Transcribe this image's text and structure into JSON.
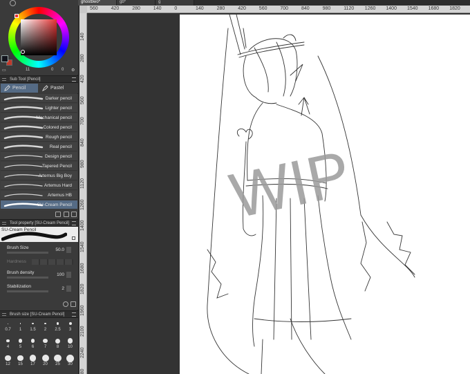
{
  "tabs": [
    {
      "label": "ghostbwo*"
    },
    {
      "label": "gb*"
    },
    {
      "label": "g"
    }
  ],
  "ruler": {
    "top": [
      "560",
      "420",
      "280",
      "140",
      "0",
      "140",
      "280",
      "420",
      "560",
      "700",
      "840",
      "980",
      "1120",
      "1260",
      "1400",
      "1540",
      "1680",
      "1820"
    ],
    "left": [
      "140",
      "280",
      "420",
      "560",
      "700",
      "840",
      "980",
      "1120",
      "1260",
      "1400",
      "1540",
      "1680",
      "1820",
      "1960",
      "2100",
      "2240",
      "2380"
    ]
  },
  "color_panel": {
    "main_color": "#12141c",
    "sub_color": "#c0392b",
    "hue_color": "#e53535",
    "info": {
      "brush_count": "11",
      "val1": "0",
      "val2": "0"
    }
  },
  "sub_tool": {
    "title": "Sub Tool [Pencil]",
    "tabs": [
      {
        "label": "Pencil",
        "icon": "pencil-icon",
        "active": true
      },
      {
        "label": "Pastel",
        "icon": "pastel-icon",
        "active": false
      }
    ],
    "items": [
      {
        "name": "Darker pencil",
        "selected": false
      },
      {
        "name": "Lighter pencil",
        "selected": false
      },
      {
        "name": "Mechanical pencil",
        "selected": false
      },
      {
        "name": "Colored pencil",
        "selected": false
      },
      {
        "name": "Rough pencil",
        "selected": false
      },
      {
        "name": "Real pencil",
        "selected": false
      },
      {
        "name": "Design pencil",
        "selected": false
      },
      {
        "name": "Tapered Pencil",
        "selected": false
      },
      {
        "name": "Artemus Big Boy",
        "selected": false
      },
      {
        "name": "Artemus Hard",
        "selected": false
      },
      {
        "name": "Artemus HB",
        "selected": false
      },
      {
        "name": "SU-Cream Pencil",
        "selected": true
      }
    ]
  },
  "tool_property": {
    "title": "Tool property [SU-Cream Pencil]",
    "preview_name": "SU-Cream Pencil",
    "brush_size": {
      "label": "Brush Size",
      "value": "50.0"
    },
    "hardness": {
      "label": "Hardness"
    },
    "brush_density": {
      "label": "Brush density",
      "value": "100"
    },
    "stabilization": {
      "label": "Stabilization",
      "value": "2"
    }
  },
  "brush_size_panel": {
    "title": "Brush size [SU-Cream Pencil]",
    "sizes": [
      "0.7",
      "1",
      "1.5",
      "2",
      "2.5",
      "3",
      "4",
      "5",
      "6",
      "7",
      "8",
      "10",
      "12",
      "15",
      "17",
      "20",
      "25",
      "30"
    ]
  },
  "canvas": {
    "watermark": "WIP"
  }
}
